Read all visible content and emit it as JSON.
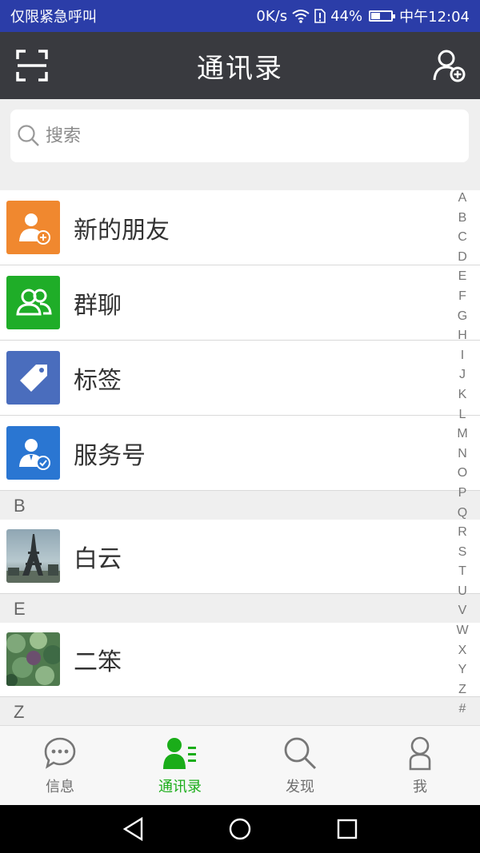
{
  "status": {
    "carrier": "仅限紧急呼叫",
    "speed": "0K/s",
    "battery": "44%",
    "battery_level": 0.44,
    "time": "中午12:04"
  },
  "header": {
    "title": "通讯录"
  },
  "search": {
    "placeholder": "搜索"
  },
  "top_items": [
    {
      "label": "新的朋友",
      "icon": "add-friend-icon",
      "color": "#f0882f"
    },
    {
      "label": "群聊",
      "icon": "group-chat-icon",
      "color": "#1fad28"
    },
    {
      "label": "标签",
      "icon": "tag-icon",
      "color": "#4a6dbd"
    },
    {
      "label": "服务号",
      "icon": "service-account-icon",
      "color": "#2a76d2"
    }
  ],
  "sections": [
    {
      "letter": "B",
      "contacts": [
        {
          "name": "白云",
          "avatar": "eiffel-tower-photo"
        }
      ]
    },
    {
      "letter": "E",
      "contacts": [
        {
          "name": "二笨",
          "avatar": "plants-photo"
        }
      ]
    },
    {
      "letter": "Z",
      "contacts": []
    }
  ],
  "index_letters": [
    "A",
    "B",
    "C",
    "D",
    "E",
    "F",
    "G",
    "H",
    "I",
    "J",
    "K",
    "L",
    "M",
    "N",
    "O",
    "P",
    "Q",
    "R",
    "S",
    "T",
    "U",
    "V",
    "W",
    "X",
    "Y",
    "Z",
    "#"
  ],
  "tabs": [
    {
      "label": "信息",
      "icon": "chat-bubble-icon"
    },
    {
      "label": "通讯录",
      "icon": "contacts-icon",
      "active": true
    },
    {
      "label": "发现",
      "icon": "search-icon"
    },
    {
      "label": "我",
      "icon": "person-icon"
    }
  ],
  "colors": {
    "status_bar": "#2b3da8",
    "title_bar": "#393a3f",
    "accent": "#1aad19"
  }
}
